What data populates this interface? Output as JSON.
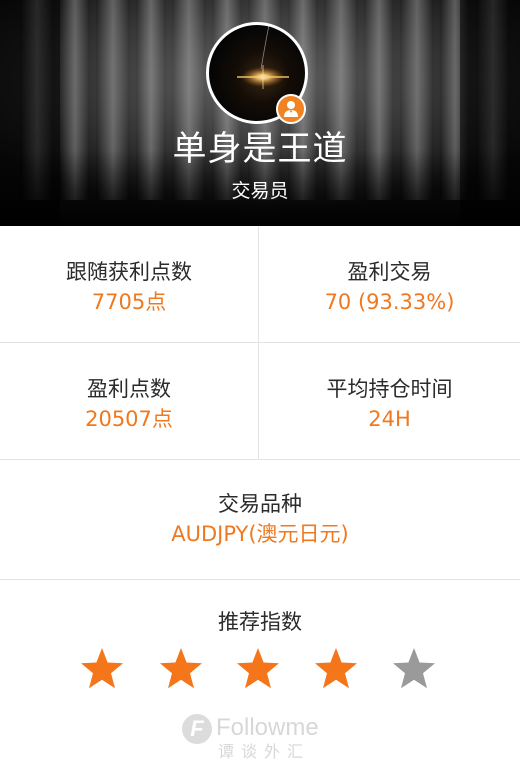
{
  "profile": {
    "username": "单身是王道",
    "role": "交易员",
    "role_icon": "person-icon",
    "avatar_icon": "light-flare"
  },
  "stats": {
    "follow_profit_points": {
      "label": "跟随获利点数",
      "value": "7705点"
    },
    "profitable_trades": {
      "label": "盈利交易",
      "value": "70 (93.33%)"
    },
    "profit_points": {
      "label": "盈利点数",
      "value": "20507点"
    },
    "avg_hold_time": {
      "label": "平均持仓时间",
      "value": "24H"
    },
    "instrument": {
      "label": "交易品种",
      "value": "AUDJPY(澳元日元)"
    }
  },
  "rating": {
    "title": "推荐指数",
    "score": 4,
    "max": 5,
    "icon": "star-icon"
  },
  "watermark": {
    "logo_letter": "F",
    "brand": "Followme",
    "sub": "谭谈外汇"
  },
  "colors": {
    "accent": "#f0781e",
    "star_filled": "#f5751b",
    "star_empty": "#9a9a9a",
    "badge": "#f18322"
  }
}
